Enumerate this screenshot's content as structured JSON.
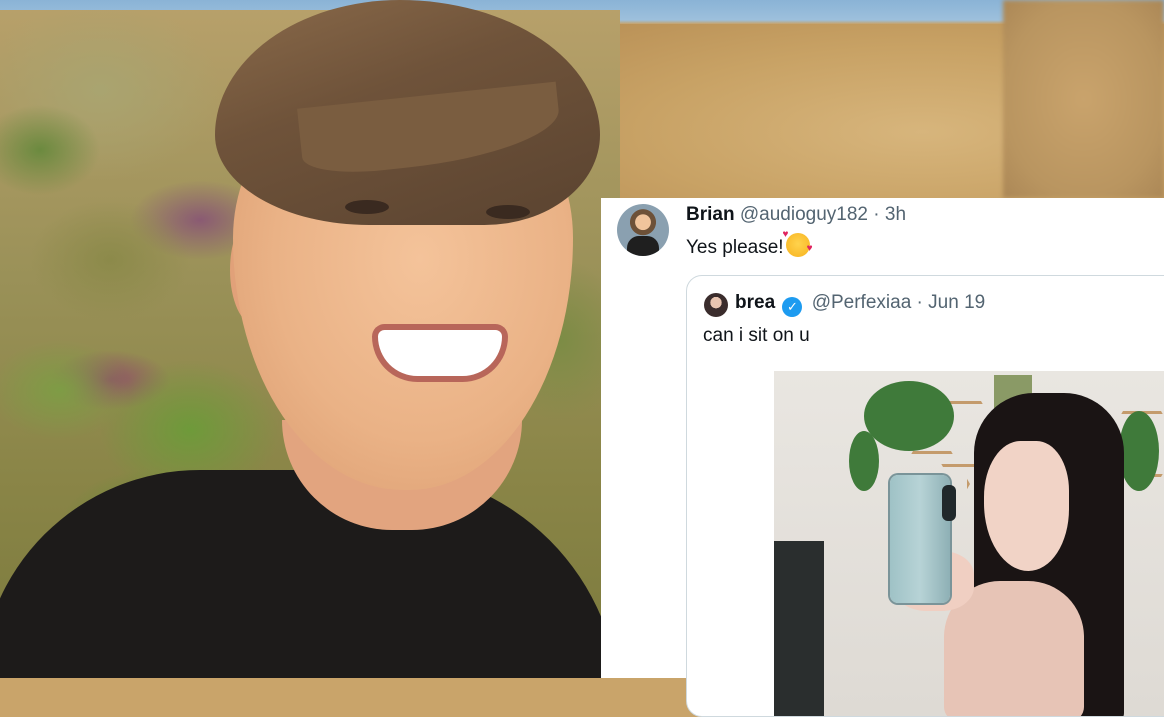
{
  "tweet": {
    "author_name": "Brian",
    "author_handle": "@audioguy182",
    "separator": "·",
    "time": "3h",
    "text": "Yes please!",
    "emoji": "smiling-face-with-hearts",
    "quoted": {
      "author_name": "brea",
      "author_handle": "@Perfexiaa",
      "separator": "·",
      "date": "Jun 19",
      "verified": true,
      "text": "can i sit on u"
    }
  },
  "colors": {
    "verified_badge": "#1d9bf0",
    "secondary_text": "#536471",
    "primary_text": "#0f1419"
  }
}
